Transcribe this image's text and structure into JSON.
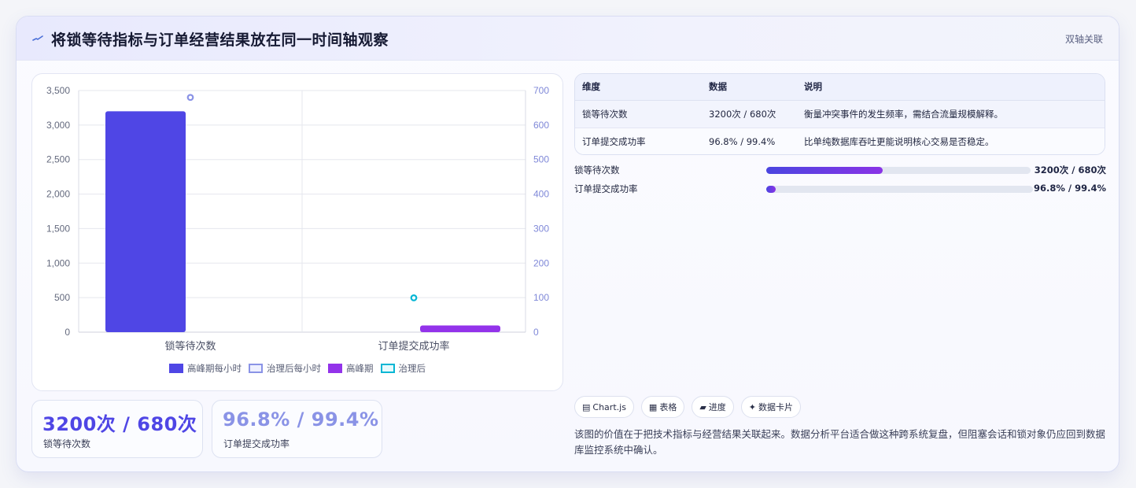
{
  "header": {
    "title": "将锁等待指标与订单经营结果放在同一时间轴观察",
    "badge": "双轴关联",
    "icon": "pulse-icon"
  },
  "chart_data": {
    "type": "bar",
    "categories": [
      "锁等待次数",
      "订单提交成功率"
    ],
    "y_left": {
      "min": 0,
      "max": 3500,
      "ticks": [
        "0",
        "500",
        "1,000",
        "1,500",
        "2,000",
        "2,500",
        "3,000",
        "3,500"
      ]
    },
    "y_right": {
      "min": 0,
      "max": 700,
      "ticks": [
        "0",
        "100",
        "200",
        "300",
        "400",
        "500",
        "600",
        "700"
      ]
    },
    "series": [
      {
        "name": "高峰期每小时",
        "kind": "bar",
        "axis": "left",
        "color": "#4f46e5",
        "values": [
          3200,
          null
        ]
      },
      {
        "name": "治理后每小时",
        "kind": "point",
        "axis": "right",
        "color": "#8a93e6",
        "values": [
          680,
          null
        ]
      },
      {
        "name": "高峰期",
        "kind": "bar",
        "axis": "left",
        "color": "#9333ea",
        "values": [
          null,
          96.8
        ]
      },
      {
        "name": "治理后",
        "kind": "point",
        "axis": "right",
        "color": "#06b6d4",
        "values": [
          null,
          99.4
        ]
      }
    ],
    "grid": true,
    "legend": "bottom"
  },
  "kpis": [
    {
      "value": "3200次 / 680次",
      "label": "锁等待次数",
      "color": "#4f46e5"
    },
    {
      "value": "96.8% / 99.4%",
      "label": "订单提交成功率",
      "color": "#8a93e6"
    }
  ],
  "table": {
    "headers": [
      "维度",
      "数据",
      "说明"
    ],
    "rows": [
      [
        "锁等待次数",
        "3200次 / 680次",
        "衡量冲突事件的发生频率，需结合流量规模解释。"
      ],
      [
        "订单提交成功率",
        "96.8% / 99.4%",
        "比单纯数据库吞吐更能说明核心交易是否稳定。"
      ]
    ]
  },
  "progress": [
    {
      "label": "锁等待次数",
      "value": "3200次 / 680次",
      "fraction": 0.44
    },
    {
      "label": "订单提交成功率",
      "value": "96.8% / 99.4%",
      "fraction": 0.03
    }
  ],
  "tags": [
    {
      "icon": "chart-icon",
      "glyph": "▤",
      "label": "Chart.js"
    },
    {
      "icon": "table-icon",
      "glyph": "▦",
      "label": "表格"
    },
    {
      "icon": "progress-icon",
      "glyph": "▰",
      "label": "进度"
    },
    {
      "icon": "sparkle-icon",
      "glyph": "✦",
      "label": "数据卡片"
    }
  ],
  "description": "该图的价值在于把技术指标与经营结果关联起来。数据分析平台适合做这种跨系统复盘，但阻塞会话和锁对象仍应回到数据库监控系统中确认。"
}
